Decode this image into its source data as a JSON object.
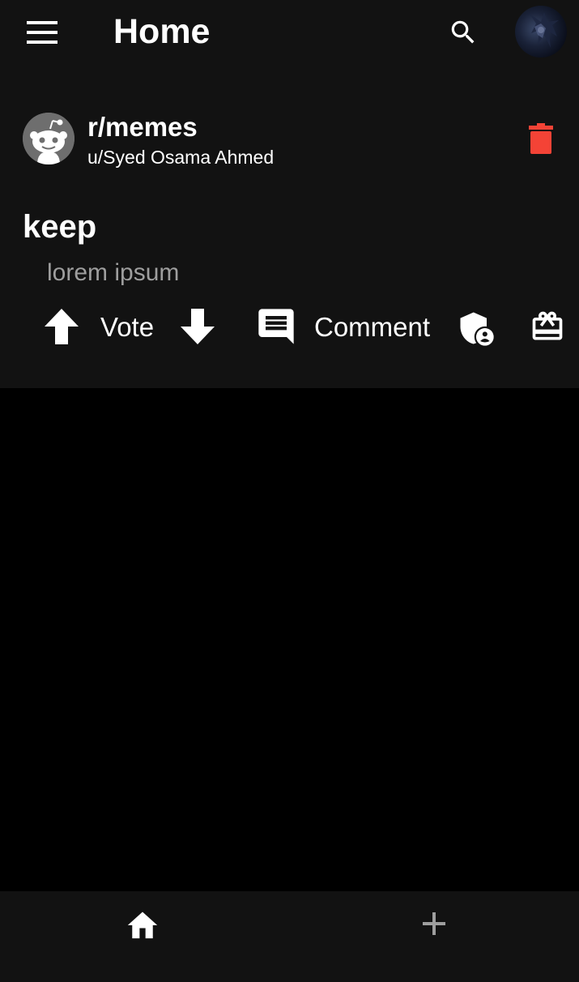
{
  "app_bar": {
    "title": "Home",
    "menu_icon": "menu-icon",
    "search_icon": "search-icon",
    "avatar_icon": "profile-avatar"
  },
  "post": {
    "subreddit": "r/memes",
    "author": "u/Syed Osama Ahmed",
    "title": "keep",
    "body": "lorem ipsum",
    "delete_icon": "trash-icon",
    "actions": {
      "upvote_icon": "arrow-up-icon",
      "vote_label": "Vote",
      "downvote_icon": "arrow-down-icon",
      "comment_icon": "comment-icon",
      "comment_label": "Comment",
      "moderator_icon": "admin-shield-icon",
      "award_icon": "gift-card-icon"
    }
  },
  "bottom_nav": {
    "home_icon": "home-icon",
    "create_icon": "plus-icon"
  },
  "colors": {
    "background": "#000000",
    "surface": "#121212",
    "text_primary": "#ffffff",
    "text_secondary": "#9e9e9e",
    "delete": "#f44336",
    "inactive_nav": "#9e9e9e"
  }
}
